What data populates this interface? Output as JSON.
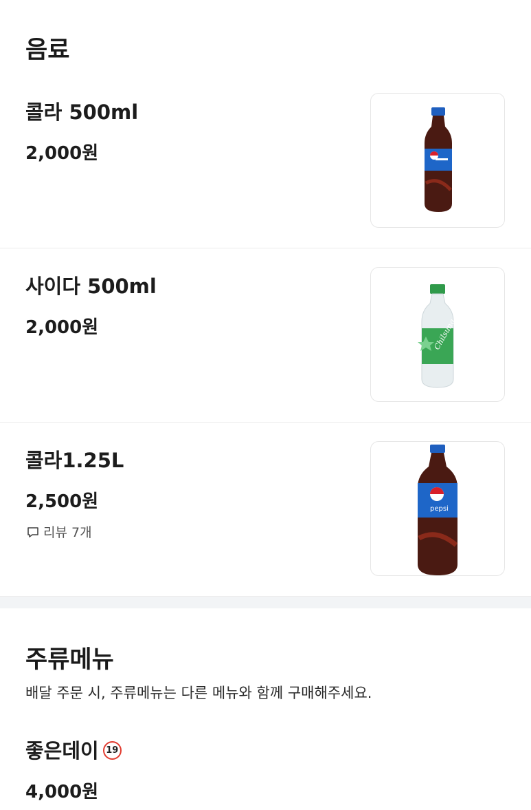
{
  "sections": [
    {
      "title": "음료",
      "items": [
        {
          "name": "콜라 500ml",
          "price": "2,000원",
          "image_icon": "pepsi-500ml-bottle"
        },
        {
          "name": "사이다 500ml",
          "price": "2,000원",
          "image_icon": "chilsung-cider-bottle"
        },
        {
          "name": "콜라1.25L",
          "price": "2,500원",
          "review": "리뷰 7개",
          "image_icon": "pepsi-1.25l-bottle"
        }
      ]
    },
    {
      "title": "주류메뉴",
      "notice": "배달 주문 시, 주류메뉴는 다른 메뉴와 함께 구매해주세요.",
      "items": [
        {
          "name": "좋은데이",
          "badge": "19",
          "price": "4,000원"
        }
      ]
    }
  ],
  "colors": {
    "age_badge": "#e23b2f",
    "divider": "#f2f4f6"
  }
}
